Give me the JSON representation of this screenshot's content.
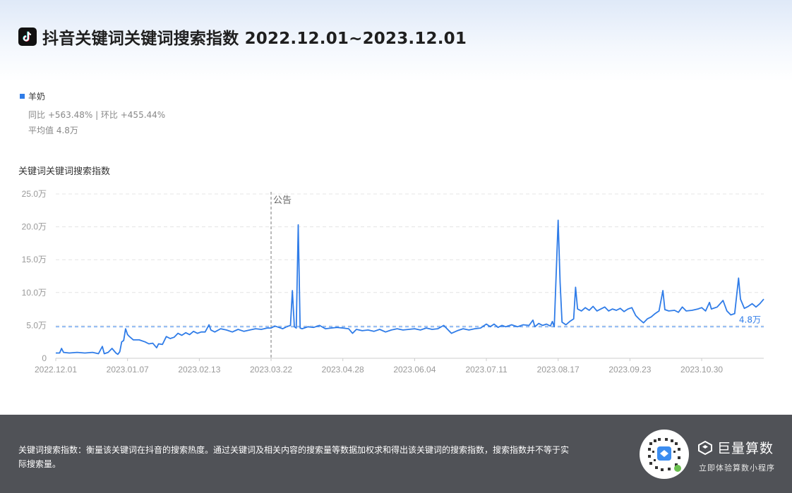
{
  "header": {
    "title": "抖音关键词关键词搜索指数 2022.12.01~2023.12.01"
  },
  "legend": {
    "label": "羊奶",
    "color": "#2f7ce8"
  },
  "stats": {
    "yoy_mom": "同比 +563.48% | 环比 +455.44%",
    "average": "平均值 4.8万"
  },
  "chart_data": {
    "type": "line",
    "title": "关键词关键词搜索指数",
    "ylim": [
      0,
      25
    ],
    "y_ticks": [
      "0",
      "5.0万",
      "10.0万",
      "15.0万",
      "20.0万",
      "25.0万"
    ],
    "x_ticks": [
      "2022.12.01",
      "2023.01.07",
      "2023.02.13",
      "2023.03.22",
      "2023.04.28",
      "2023.06.04",
      "2023.07.11",
      "2023.08.17",
      "2023.09.23",
      "2023.10.30"
    ],
    "annotation": {
      "label": "公告",
      "x": "2023.03.22"
    },
    "average_line": {
      "value": 4.8,
      "label": "4.8万"
    },
    "series": [
      {
        "name": "羊奶",
        "color": "#2f7ce8",
        "points": [
          [
            "2022.12.01",
            0.8
          ],
          [
            "2022.12.03",
            0.8
          ],
          [
            "2022.12.04",
            1.5
          ],
          [
            "2022.12.05",
            0.9
          ],
          [
            "2022.12.08",
            0.8
          ],
          [
            "2022.12.12",
            0.9
          ],
          [
            "2022.12.16",
            0.8
          ],
          [
            "2022.12.20",
            0.9
          ],
          [
            "2022.12.23",
            0.7
          ],
          [
            "2022.12.25",
            1.8
          ],
          [
            "2022.12.26",
            0.7
          ],
          [
            "2022.12.28",
            0.9
          ],
          [
            "2022.12.30",
            1.5
          ],
          [
            "2023.01.01",
            0.8
          ],
          [
            "2023.01.02",
            0.6
          ],
          [
            "2023.01.03",
            1.0
          ],
          [
            "2023.01.04",
            2.5
          ],
          [
            "2023.01.05",
            2.7
          ],
          [
            "2023.01.06",
            4.5
          ],
          [
            "2023.01.07",
            3.6
          ],
          [
            "2023.01.08",
            3.3
          ],
          [
            "2023.01.10",
            2.8
          ],
          [
            "2023.01.13",
            2.8
          ],
          [
            "2023.01.16",
            2.5
          ],
          [
            "2023.01.18",
            2.2
          ],
          [
            "2023.01.20",
            2.3
          ],
          [
            "2023.01.22",
            1.6
          ],
          [
            "2023.01.23",
            2.2
          ],
          [
            "2023.01.25",
            2.1
          ],
          [
            "2023.01.27",
            3.3
          ],
          [
            "2023.01.29",
            3.0
          ],
          [
            "2023.01.31",
            3.2
          ],
          [
            "2023.02.02",
            3.8
          ],
          [
            "2023.02.04",
            3.5
          ],
          [
            "2023.02.06",
            3.9
          ],
          [
            "2023.02.08",
            3.6
          ],
          [
            "2023.02.10",
            4.1
          ],
          [
            "2023.02.12",
            3.8
          ],
          [
            "2023.02.14",
            4.0
          ],
          [
            "2023.02.16",
            4.0
          ],
          [
            "2023.02.18",
            5.1
          ],
          [
            "2023.02.19",
            4.3
          ],
          [
            "2023.02.21",
            4.0
          ],
          [
            "2023.02.24",
            4.5
          ],
          [
            "2023.02.27",
            4.3
          ],
          [
            "2023.03.02",
            4.0
          ],
          [
            "2023.03.05",
            4.4
          ],
          [
            "2023.03.08",
            4.1
          ],
          [
            "2023.03.11",
            4.3
          ],
          [
            "2023.03.14",
            4.5
          ],
          [
            "2023.03.17",
            4.4
          ],
          [
            "2023.03.20",
            4.6
          ],
          [
            "2023.03.22",
            4.6
          ],
          [
            "2023.03.24",
            4.9
          ],
          [
            "2023.03.26",
            4.7
          ],
          [
            "2023.03.28",
            4.5
          ],
          [
            "2023.03.30",
            4.8
          ],
          [
            "2023.04.01",
            5.0
          ],
          [
            "2023.04.02",
            10.3
          ],
          [
            "2023.04.03",
            4.8
          ],
          [
            "2023.04.04",
            4.6
          ],
          [
            "2023.04.05",
            20.3
          ],
          [
            "2023.04.06",
            4.6
          ],
          [
            "2023.04.07",
            4.5
          ],
          [
            "2023.04.10",
            4.8
          ],
          [
            "2023.04.13",
            4.7
          ],
          [
            "2023.04.16",
            5.0
          ],
          [
            "2023.04.19",
            4.5
          ],
          [
            "2023.04.22",
            4.6
          ],
          [
            "2023.04.25",
            4.7
          ],
          [
            "2023.04.28",
            4.6
          ],
          [
            "2023.05.01",
            4.5
          ],
          [
            "2023.05.03",
            3.8
          ],
          [
            "2023.05.05",
            4.4
          ],
          [
            "2023.05.08",
            4.2
          ],
          [
            "2023.05.11",
            4.3
          ],
          [
            "2023.05.14",
            4.1
          ],
          [
            "2023.05.17",
            4.4
          ],
          [
            "2023.05.20",
            4.0
          ],
          [
            "2023.05.23",
            4.3
          ],
          [
            "2023.05.26",
            4.5
          ],
          [
            "2023.05.29",
            4.3
          ],
          [
            "2023.06.01",
            4.4
          ],
          [
            "2023.06.04",
            4.5
          ],
          [
            "2023.06.07",
            4.3
          ],
          [
            "2023.06.10",
            4.6
          ],
          [
            "2023.06.13",
            4.4
          ],
          [
            "2023.06.16",
            4.5
          ],
          [
            "2023.06.19",
            5.0
          ],
          [
            "2023.06.21",
            4.4
          ],
          [
            "2023.06.23",
            3.8
          ],
          [
            "2023.06.26",
            4.2
          ],
          [
            "2023.06.29",
            4.5
          ],
          [
            "2023.07.02",
            4.3
          ],
          [
            "2023.07.05",
            4.5
          ],
          [
            "2023.07.08",
            4.6
          ],
          [
            "2023.07.11",
            5.2
          ],
          [
            "2023.07.13",
            4.8
          ],
          [
            "2023.07.15",
            5.2
          ],
          [
            "2023.07.17",
            4.7
          ],
          [
            "2023.07.19",
            5.0
          ],
          [
            "2023.07.21",
            4.8
          ],
          [
            "2023.07.24",
            5.1
          ],
          [
            "2023.07.27",
            4.8
          ],
          [
            "2023.07.30",
            5.1
          ],
          [
            "2023.08.02",
            5.0
          ],
          [
            "2023.08.04",
            5.8
          ],
          [
            "2023.08.05",
            4.8
          ],
          [
            "2023.08.07",
            5.3
          ],
          [
            "2023.08.09",
            5.0
          ],
          [
            "2023.08.11",
            5.2
          ],
          [
            "2023.08.13",
            4.9
          ],
          [
            "2023.08.14",
            5.6
          ],
          [
            "2023.08.15",
            4.8
          ],
          [
            "2023.08.17",
            21.0
          ],
          [
            "2023.08.18",
            11.5
          ],
          [
            "2023.08.19",
            5.5
          ],
          [
            "2023.08.21",
            5.1
          ],
          [
            "2023.08.23",
            5.6
          ],
          [
            "2023.08.25",
            6.0
          ],
          [
            "2023.08.26",
            10.8
          ],
          [
            "2023.08.27",
            7.5
          ],
          [
            "2023.08.29",
            7.2
          ],
          [
            "2023.08.31",
            7.7
          ],
          [
            "2023.09.02",
            7.3
          ],
          [
            "2023.09.04",
            7.9
          ],
          [
            "2023.09.06",
            7.2
          ],
          [
            "2023.09.08",
            7.5
          ],
          [
            "2023.09.10",
            7.8
          ],
          [
            "2023.09.12",
            7.2
          ],
          [
            "2023.09.14",
            7.5
          ],
          [
            "2023.09.16",
            7.3
          ],
          [
            "2023.09.18",
            7.6
          ],
          [
            "2023.09.20",
            7.1
          ],
          [
            "2023.09.22",
            7.5
          ],
          [
            "2023.09.24",
            7.7
          ],
          [
            "2023.09.26",
            6.5
          ],
          [
            "2023.09.28",
            5.9
          ],
          [
            "2023.09.30",
            5.4
          ],
          [
            "2023.10.02",
            6.0
          ],
          [
            "2023.10.04",
            6.3
          ],
          [
            "2023.10.06",
            6.8
          ],
          [
            "2023.10.08",
            7.2
          ],
          [
            "2023.10.10",
            10.3
          ],
          [
            "2023.10.11",
            7.4
          ],
          [
            "2023.10.13",
            7.2
          ],
          [
            "2023.10.16",
            7.3
          ],
          [
            "2023.10.18",
            7.0
          ],
          [
            "2023.10.20",
            7.8
          ],
          [
            "2023.10.22",
            7.2
          ],
          [
            "2023.10.25",
            7.3
          ],
          [
            "2023.10.28",
            7.5
          ],
          [
            "2023.10.30",
            7.7
          ],
          [
            "2023.11.01",
            7.2
          ],
          [
            "2023.11.03",
            8.5
          ],
          [
            "2023.11.04",
            7.5
          ],
          [
            "2023.11.07",
            7.8
          ],
          [
            "2023.11.10",
            8.8
          ],
          [
            "2023.11.12",
            7.2
          ],
          [
            "2023.11.14",
            6.6
          ],
          [
            "2023.11.16",
            6.8
          ],
          [
            "2023.11.18",
            12.2
          ],
          [
            "2023.11.19",
            9.0
          ],
          [
            "2023.11.21",
            7.6
          ],
          [
            "2023.11.23",
            7.9
          ],
          [
            "2023.11.25",
            8.3
          ],
          [
            "2023.11.27",
            7.8
          ],
          [
            "2023.11.29",
            8.3
          ],
          [
            "2023.12.01",
            9.0
          ]
        ]
      }
    ]
  },
  "footer": {
    "description": "关键词搜索指数：衡量该关键词在抖音的搜索热度。通过关键词及相关内容的搜索量等数据加权求和得出该关键词的搜索指数，搜索指数并不等于实际搜索量。",
    "brand_name": "巨量算数",
    "brand_sub": "立即体验算数小程序",
    "qr_icon": "qr-code-icon"
  }
}
